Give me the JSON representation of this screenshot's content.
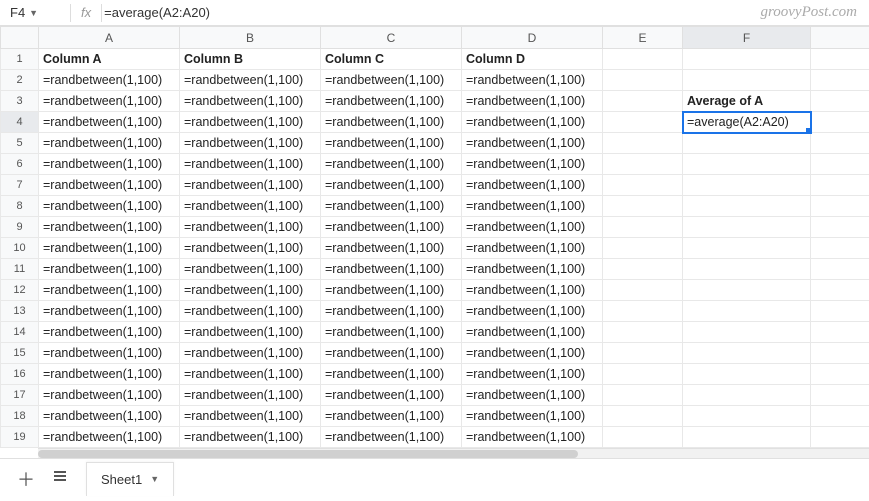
{
  "formula_bar": {
    "cell_ref": "F4",
    "fx_label": "fx",
    "formula": "=average(A2:A20)"
  },
  "watermark": "groovyPost.com",
  "columns": [
    "A",
    "B",
    "C",
    "D",
    "E",
    "F"
  ],
  "row_numbers": [
    "1",
    "2",
    "3",
    "4",
    "5",
    "6",
    "7",
    "8",
    "9",
    "10",
    "11",
    "12",
    "13",
    "14",
    "15",
    "16",
    "17",
    "18",
    "19"
  ],
  "headers": {
    "a": "Column A",
    "b": "Column B",
    "c": "Column C",
    "d": "Column D"
  },
  "cell_text": {
    "rand": "=randbetween(1,100)",
    "avg_label": "Average of A",
    "avg_formula": "=average(A2:A20)"
  },
  "selected_cell": "F4",
  "sheet_bar": {
    "sheet_name": "Sheet1"
  }
}
